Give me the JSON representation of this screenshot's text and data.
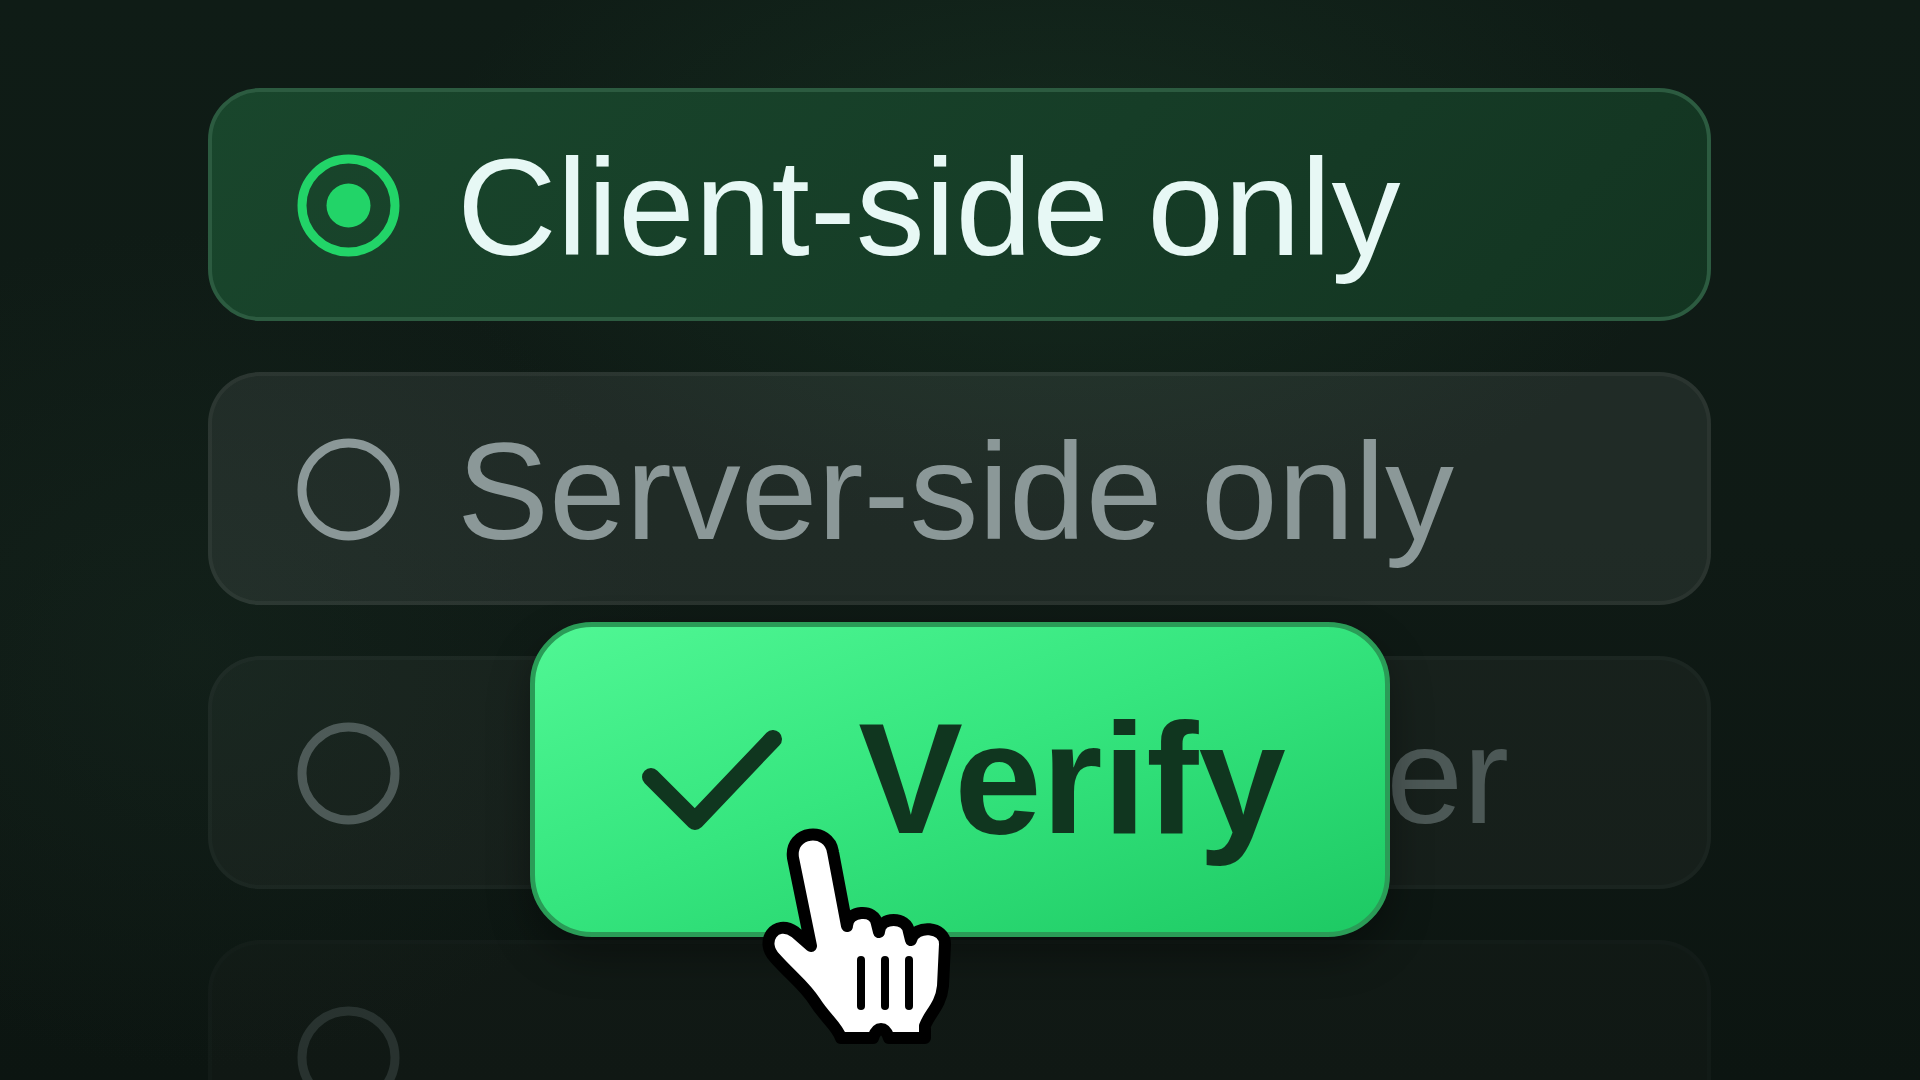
{
  "options": [
    {
      "label": "Client-side only",
      "selected": true
    },
    {
      "label": "Server-side only",
      "selected": false
    },
    {
      "label_end": "er",
      "selected": false
    },
    {
      "selected": false
    }
  ],
  "verify_button": {
    "label": "Verify"
  }
}
